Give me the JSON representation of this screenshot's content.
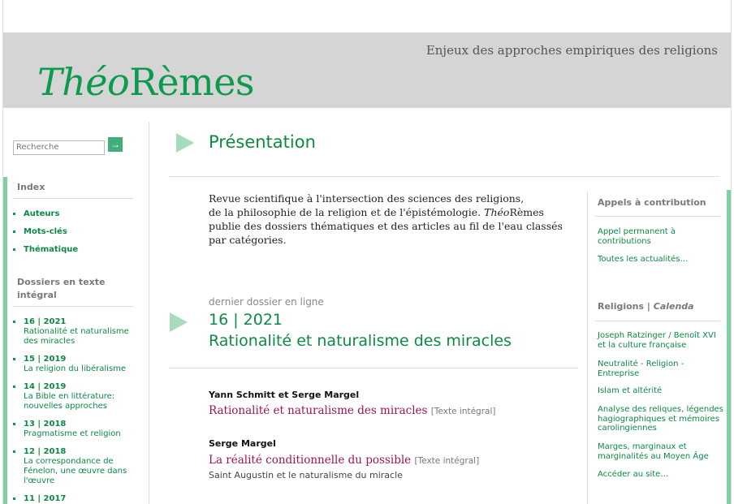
{
  "site": {
    "tagline": "Enjeux des approches empiriques des religions",
    "logo_italic": "Théo",
    "logo_rest": "Rèmes"
  },
  "search": {
    "placeholder": "Recherche",
    "button_icon": "arrow-right-icon"
  },
  "sidebar": {
    "index_heading": "Index",
    "index_items": [
      "Auteurs",
      "Mots-clés",
      "Thématique"
    ],
    "dossiers_heading_1": "Dossiers en texte",
    "dossiers_heading_2": "intégral",
    "dossiers": [
      {
        "num": "16 | 2021",
        "line1": "Rationalité et naturalisme",
        "line2": "des miracles",
        "line3": ""
      },
      {
        "num": "15 | 2019",
        "line1": "La religion du libéralisme",
        "line2": "",
        "line3": ""
      },
      {
        "num": "14 | 2019",
        "line1": "La Bible en littérature:",
        "line2": "nouvelles approches",
        "line3": ""
      },
      {
        "num": "13 | 2018",
        "line1": "Pragmatisme et religion",
        "line2": "",
        "line3": ""
      },
      {
        "num": "12 | 2018",
        "line1": "La correspondance de",
        "line2": "Fénelon, une œuvre dans",
        "line3": "l'œuvre"
      },
      {
        "num": "11 | 2017",
        "line1": "",
        "line2": "",
        "line3": ""
      }
    ]
  },
  "main": {
    "title": "Présentation",
    "intro_l1": "Revue scientifique à l'intersection des sciences des religions,",
    "intro_l2": "de la philosophie de la religion et de l'épistémologie.",
    "intro_l2_italic": "Théo",
    "intro_l2_rest": "Rèmes",
    "intro_l3": "publie des dossiers thématiques et des articles au fil de l'eau classés",
    "intro_l4": "par catégories.",
    "kicker": "dernier dossier en ligne",
    "issue_num": "16 | 2021",
    "issue_title": "Rationalité et naturalisme des miracles",
    "articles": [
      {
        "author": "Yann Schmitt et Serge Margel",
        "title": "Rationalité et naturalisme des miracles",
        "link": "[Texte intégral]",
        "subtitle": ""
      },
      {
        "author": "Serge Margel",
        "title": "La réalité conditionnelle du possible",
        "link": "[Texte intégral]",
        "subtitle": "Saint Augustin et le naturalisme du miracle"
      }
    ]
  },
  "right": {
    "appels_heading": "Appels à contribution",
    "appels_links": [
      "Appel permanent à contributions",
      "Toutes les actualités…"
    ],
    "religions_heading": "Religions |",
    "religions_heading_italic": "Calenda",
    "religions_links": [
      "Joseph Ratzinger / Benoît XVI et la culture française",
      "Neutralité - Religion - Entreprise",
      "Islam et altérité",
      "Analyse des reliques, légendes hagiographiques et mémoires carolingiennes",
      "Marges, marginaux et marginalités au Moyen Âge",
      "Accéder au site…"
    ]
  },
  "colors": {
    "accent": "#0c9a4d",
    "accent_light": "#7fd0a3",
    "banner": "#d5d5d5",
    "article_title": "#9c1454"
  }
}
